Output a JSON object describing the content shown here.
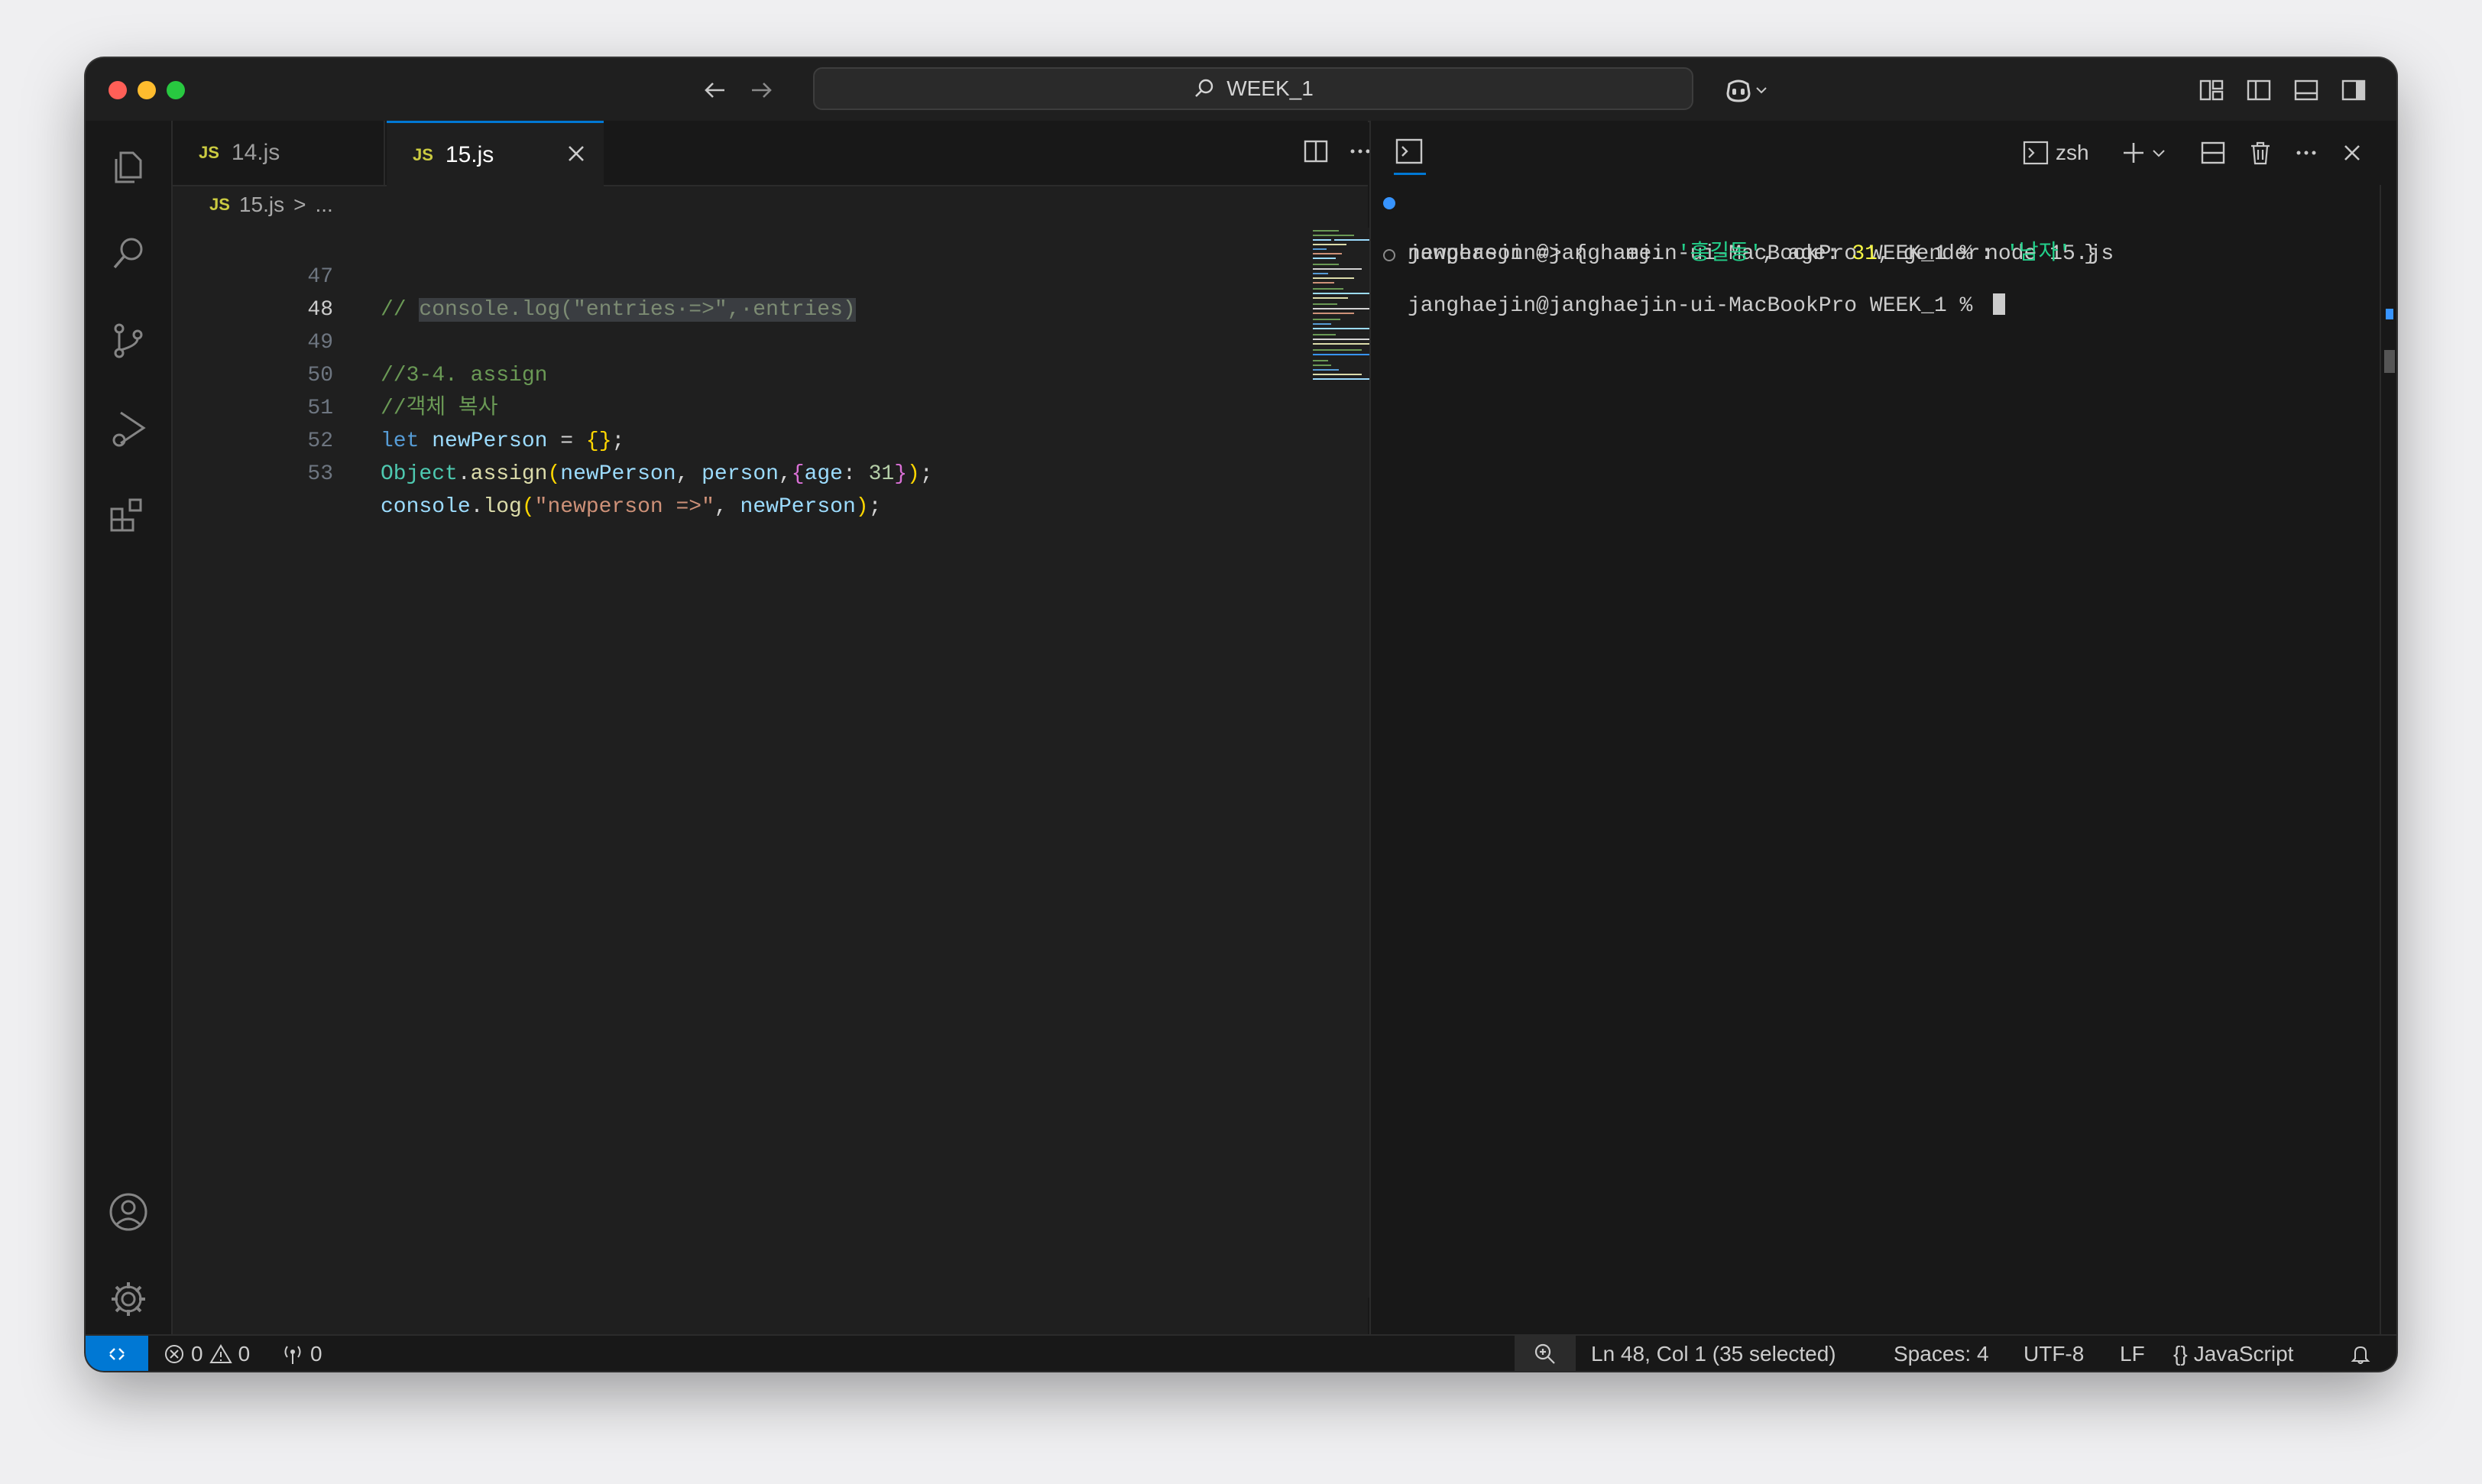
{
  "titlebar": {
    "search_text": "WEEK_1",
    "icons": [
      "back-arrow-icon",
      "forward-arrow-icon",
      "search-icon",
      "copilot-icon",
      "chevron-down-icon",
      "customize-layout-icon",
      "toggle-primary-sidebar-icon",
      "toggle-panel-icon",
      "toggle-secondary-sidebar-icon"
    ]
  },
  "activity_bar": {
    "icons": [
      "explorer-icon",
      "search-icon",
      "source-control-icon",
      "run-debug-icon",
      "extensions-icon",
      "accounts-icon",
      "manage-gear-icon"
    ]
  },
  "tabs": [
    {
      "badge": "JS",
      "label": "14.js",
      "active": false
    },
    {
      "badge": "JS",
      "label": "15.js",
      "active": true
    }
  ],
  "breadcrumb": {
    "badge": "JS",
    "file": "15.js",
    "separator": ">",
    "rest": "..."
  },
  "editor": {
    "language_accent": "#cbcb41",
    "lines": [
      {
        "num": "47",
        "active": false
      },
      {
        "num": "48",
        "active": true
      },
      {
        "num": "49",
        "active": false
      },
      {
        "num": "50",
        "active": false
      },
      {
        "num": "51",
        "active": false
      },
      {
        "num": "52",
        "active": false
      },
      {
        "num": "53",
        "active": false
      }
    ],
    "code": {
      "l47_prefix": "// ",
      "l47_selected": "console.log(\"entries·=>\",·entries)",
      "l49": "//3-4. assign",
      "l50": "//객체 복사",
      "l51_kw": "let",
      "l51_var": "newPerson",
      "l51_eq": " = ",
      "l51_br": "{}",
      "l51_end": ";",
      "l52_cls": "Object",
      "l52_dot": ".",
      "l52_fn": "assign",
      "l52_p1": "(",
      "l52_a1": "newPerson",
      "l52_c1": ", ",
      "l52_a2": "person",
      "l52_c2": ",",
      "l52_br1": "{",
      "l52_key": "age",
      "l52_colon": ": ",
      "l52_num": "31",
      "l52_br2": "}",
      "l52_p2": ")",
      "l52_end": ";",
      "l53_var1": "console",
      "l53_dot": ".",
      "l53_fn": "log",
      "l53_p1": "(",
      "l53_str": "\"newperson =>\"",
      "l53_c": ", ",
      "l53_var2": "newPerson",
      "l53_p2": ")",
      "l53_end": ";"
    }
  },
  "terminal": {
    "shell": "zsh",
    "lines": [
      {
        "prompt": "janghaejin@janghaejin-ui-MacBookPro WEEK_1 % ",
        "command": "node 15.js"
      },
      {
        "out_a": "newperson => { name: ",
        "out_str1": "'홍길동'",
        "out_b": ", age: ",
        "out_num": "31",
        "out_c": ", gender: ",
        "out_str2": "'남자'",
        "out_d": " }"
      },
      {
        "prompt": "janghaejin@janghaejin-ui-MacBookPro WEEK_1 % "
      }
    ]
  },
  "statusbar": {
    "errors": "0",
    "warnings": "0",
    "ports": "0",
    "cursor_position": "Ln 48, Col 1 (35 selected)",
    "indentation": "Spaces: 4",
    "encoding": "UTF-8",
    "eol": "LF",
    "language_braces": "{}",
    "language": "JavaScript",
    "remote_color": "#0078d4"
  }
}
